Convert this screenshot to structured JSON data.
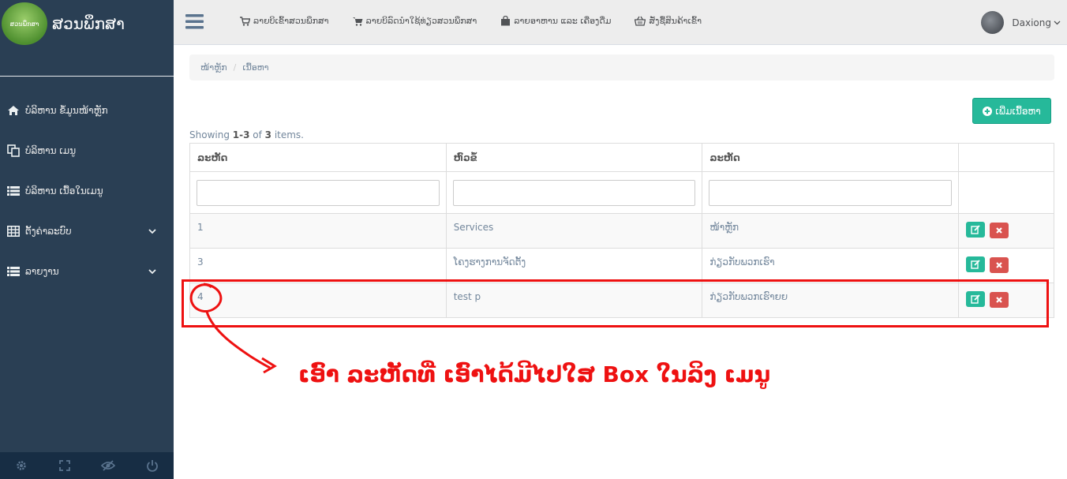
{
  "brand": {
    "logo_text": "ສວນພຶກສາ",
    "title": "ສວນພຶກສາ"
  },
  "sidebar": {
    "items": [
      {
        "label": "ບໍລິຫານ ຂໍ້ມູນໜ້າຫຼັກ",
        "icon": "home-icon"
      },
      {
        "label": "ບໍລິຫານ ເມນູ",
        "icon": "copy-icon"
      },
      {
        "label": "ບໍລິຫານ ເນື້ອໃນເມນູ",
        "icon": "list-icon"
      },
      {
        "label": "ຕັ້ງຄ່າລະບົບ",
        "icon": "table-icon",
        "has_submenu": true
      },
      {
        "label": "ລາຍງານ",
        "icon": "list-icon",
        "has_submenu": true
      }
    ],
    "footer_icons": [
      "gear-icon",
      "fullscreen-icon",
      "eye-slash-icon",
      "power-icon"
    ]
  },
  "topnav": {
    "links": [
      {
        "label": "ລາຍບິເຂົ້າສວນພຶກສາ",
        "icon": "cart-icon"
      },
      {
        "label": "ລາຍບິລົດນໍາໃຊ້ທ່ຽວສວນພຶກສາ",
        "icon": "cart-icon"
      },
      {
        "label": "ລາຍອາຫານ ແລະ ເຄື່ອງດື່ມ",
        "icon": "bag-icon"
      },
      {
        "label": "ສັ່ງຊື້ສິນຄ້າເຂົ້າ",
        "icon": "basket-icon"
      }
    ],
    "user_name": "Daxiong"
  },
  "breadcrumb": {
    "home": "ໜ້າຫຼັກ",
    "current": "ເນື້ອຫາ"
  },
  "add_button_label": "ເພີ່ມເນື້ອຫາ",
  "summary": {
    "prefix": "Showing ",
    "range": "1-3",
    "middle": " of ",
    "total": "3",
    "suffix": " items."
  },
  "table": {
    "headers": [
      "ລະຫັດ",
      "ຫົວຂໍ້",
      "ລະຫັດ",
      ""
    ],
    "rows": [
      {
        "id": "1",
        "title": "Services",
        "menu": "ໜ້າຫຼັກ"
      },
      {
        "id": "3",
        "title": "ໂຄງຮາງການຈັດຕັ້ງ",
        "menu": "ກ່ຽວກັບພວກເຮົາ"
      },
      {
        "id": "4",
        "title": "test p",
        "menu": "ກ່ຽວກັບພວກເຮົາຍຍ"
      }
    ]
  },
  "annotation": {
    "text": "ເອົາ ລະຫັດທີ່ ເອົາໄດ້ມີໄປໃສ Box ໃນລິງ ເມນູ",
    "color": "#ee1111"
  },
  "colors": {
    "sidebar": "#2a3f54",
    "accent": "#26b99a",
    "danger": "#d9534f"
  }
}
